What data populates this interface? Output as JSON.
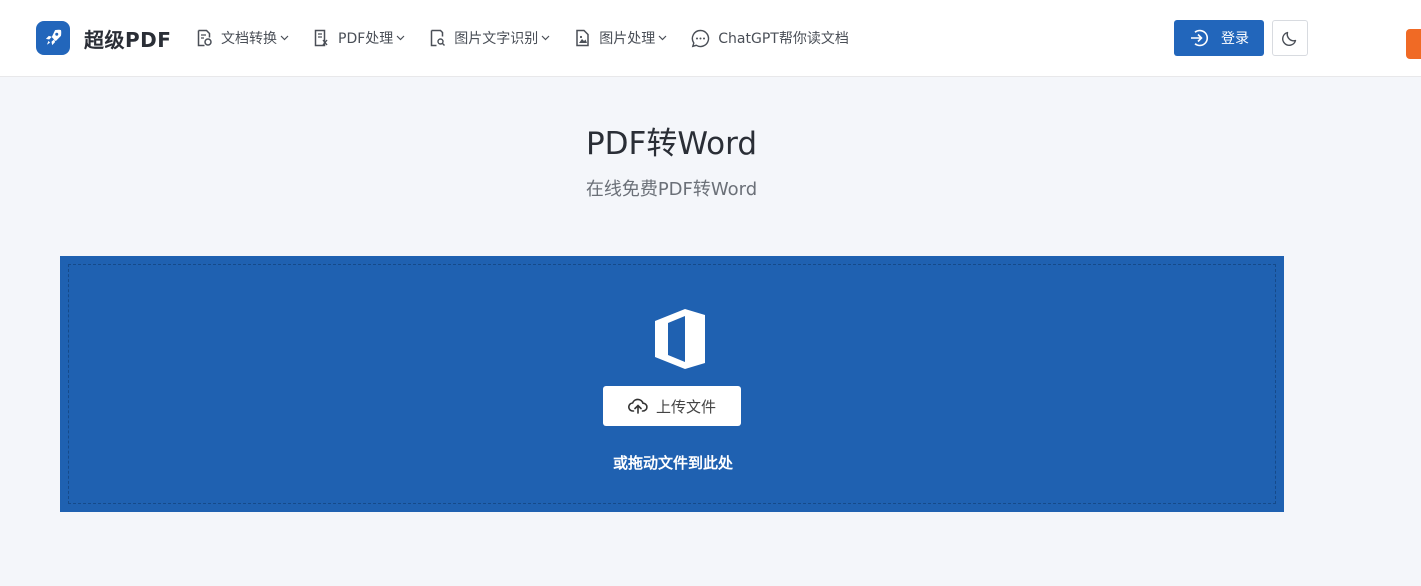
{
  "header": {
    "logo_text": "超级PDF",
    "nav": [
      {
        "label": "文档转换",
        "icon": "document-convert-icon",
        "has_dropdown": true
      },
      {
        "label": "PDF处理",
        "icon": "pdf-tool-icon",
        "has_dropdown": true
      },
      {
        "label": "图片文字识别",
        "icon": "ocr-icon",
        "has_dropdown": true
      },
      {
        "label": "图片处理",
        "icon": "image-file-icon",
        "has_dropdown": true
      },
      {
        "label": "ChatGPT帮你读文档",
        "icon": "chat-bubble-icon",
        "has_dropdown": false
      }
    ],
    "login_label": "登录",
    "theme_toggle_icon": "moon-icon"
  },
  "page": {
    "title": "PDF转Word",
    "subtitle": "在线免费PDF转Word"
  },
  "upload": {
    "button_label": "上传文件",
    "drag_hint": "或拖动文件到此处",
    "icon": "office-logo-icon"
  },
  "colors": {
    "accent": "#2266bb",
    "upload_bg": "#1f61b1",
    "page_bg": "#f4f6fa",
    "corner_badge": "#f06a25"
  }
}
